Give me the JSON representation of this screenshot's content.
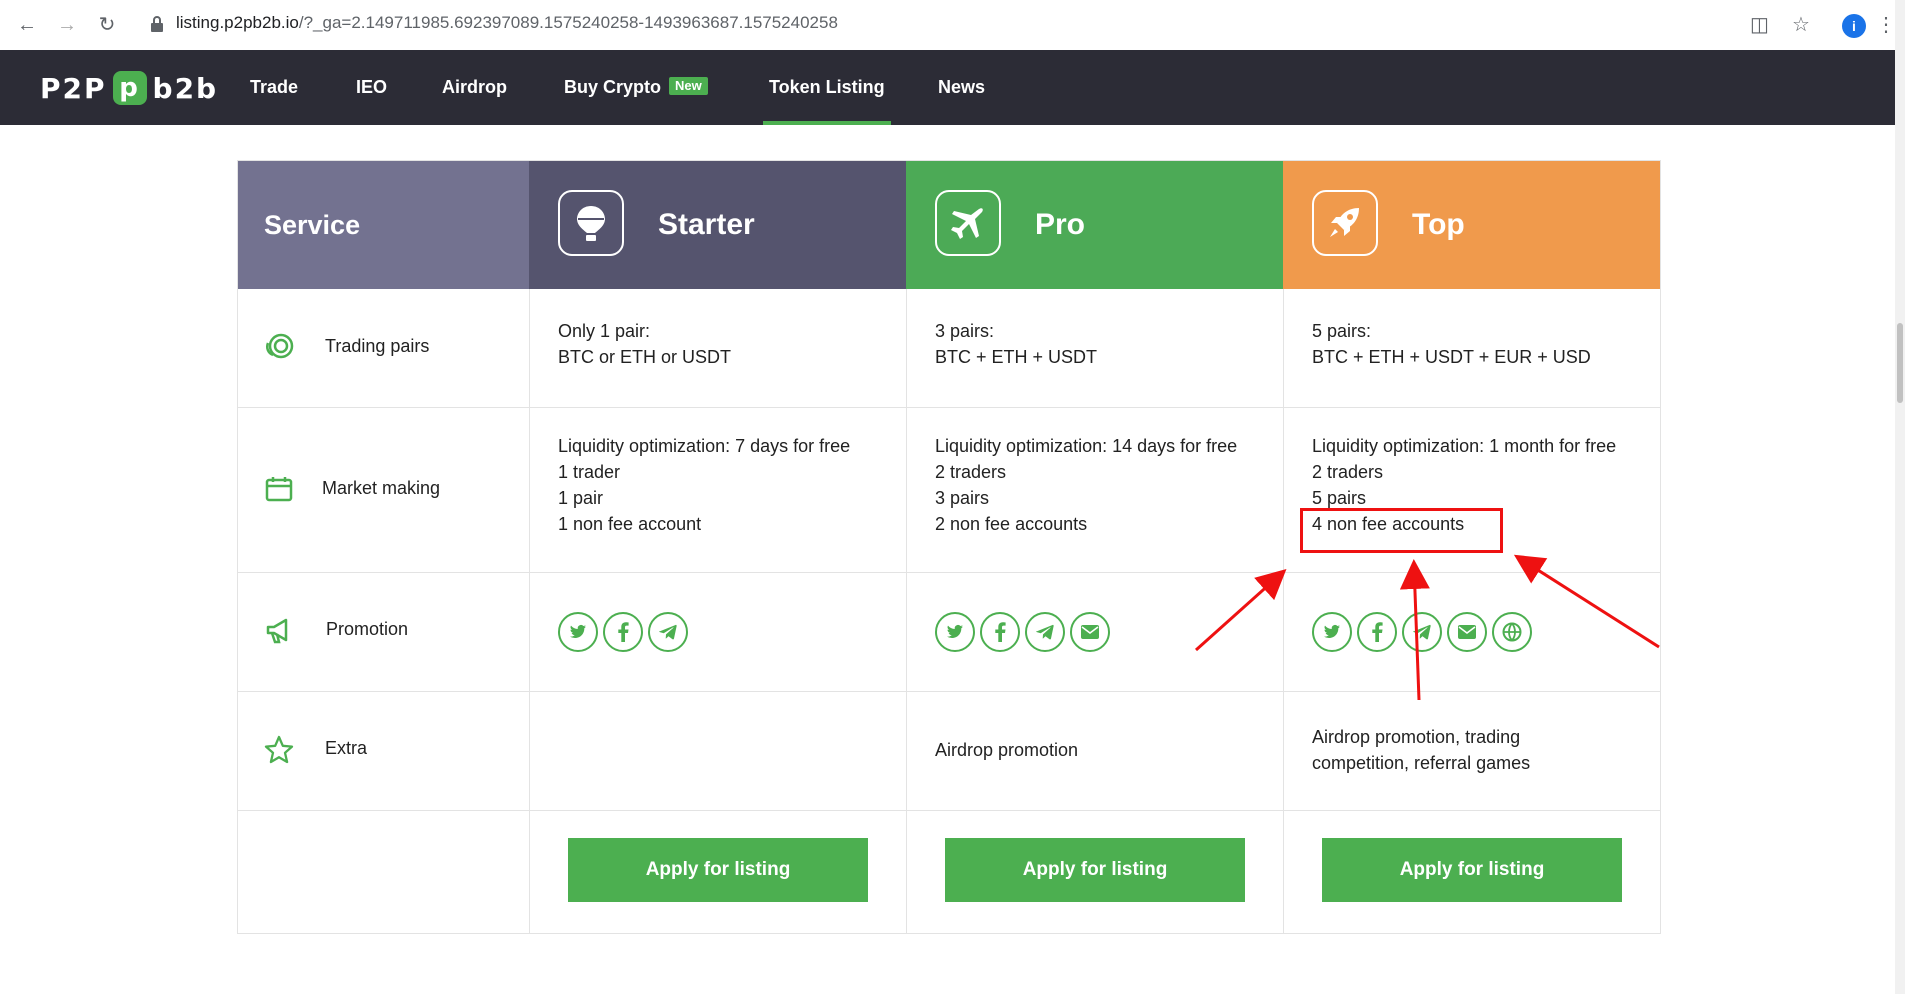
{
  "browser": {
    "url_host": "listing.p2pb2b.io",
    "url_path": "/?_ga=2.149711985.692397089.1575240258-1493963687.1575240258",
    "profile_initial": "i"
  },
  "header": {
    "logo_left": "P2P",
    "logo_box": "p",
    "logo_right": "b2b",
    "menu": [
      {
        "label": "Trade"
      },
      {
        "label": "IEO"
      },
      {
        "label": "Airdrop"
      },
      {
        "label": "Buy Crypto",
        "badge": "New"
      },
      {
        "label": "Token Listing"
      },
      {
        "label": "News"
      }
    ]
  },
  "plans": {
    "service_label": "Service",
    "starter": {
      "title": "Starter",
      "trading_pairs": [
        "Only 1 pair:",
        "BTC or ETH or USDT"
      ],
      "market_making": [
        "Liquidity optimization: 7 days for free",
        "1 trader",
        "1 pair",
        "1 non fee account"
      ],
      "extra": [],
      "apply": "Apply for listing"
    },
    "pro": {
      "title": "Pro",
      "trading_pairs": [
        "3 pairs:",
        "BTC + ETH + USDT"
      ],
      "market_making": [
        "Liquidity optimization: 14 days for free",
        "2 traders",
        "3 pairs",
        "2 non fee accounts"
      ],
      "extra": [
        "Airdrop promotion"
      ],
      "apply": "Apply for listing"
    },
    "top": {
      "title": "Top",
      "trading_pairs": [
        "5 pairs:",
        "BTC + ETH + USDT + EUR + USD"
      ],
      "market_making": [
        "Liquidity optimization: 1 month for free",
        "2 traders",
        "5 pairs",
        "4 non fee accounts"
      ],
      "extra": [
        "Airdrop promotion, trading",
        "competition, referral games"
      ],
      "apply": "Apply for listing"
    }
  },
  "rows": {
    "trading_pairs": "Trading pairs",
    "market_making": "Market making",
    "promotion": "Promotion",
    "extra": "Extra"
  },
  "colors": {
    "service_bg": "#737290",
    "starter_bg": "#55546e",
    "pro_bg": "#4caa56",
    "top_bg": "#f09a4c",
    "accent_green": "#4caf50",
    "header_bg": "#2c2c36",
    "annotation_red": "#ee1111"
  },
  "icons": {
    "starter": "balloon-icon",
    "pro": "airplane-icon",
    "top": "rocket-icon",
    "trading_pairs": "coins-icon",
    "market_making": "calendar-icon",
    "promotion": "megaphone-icon",
    "extra": "star-icon"
  }
}
